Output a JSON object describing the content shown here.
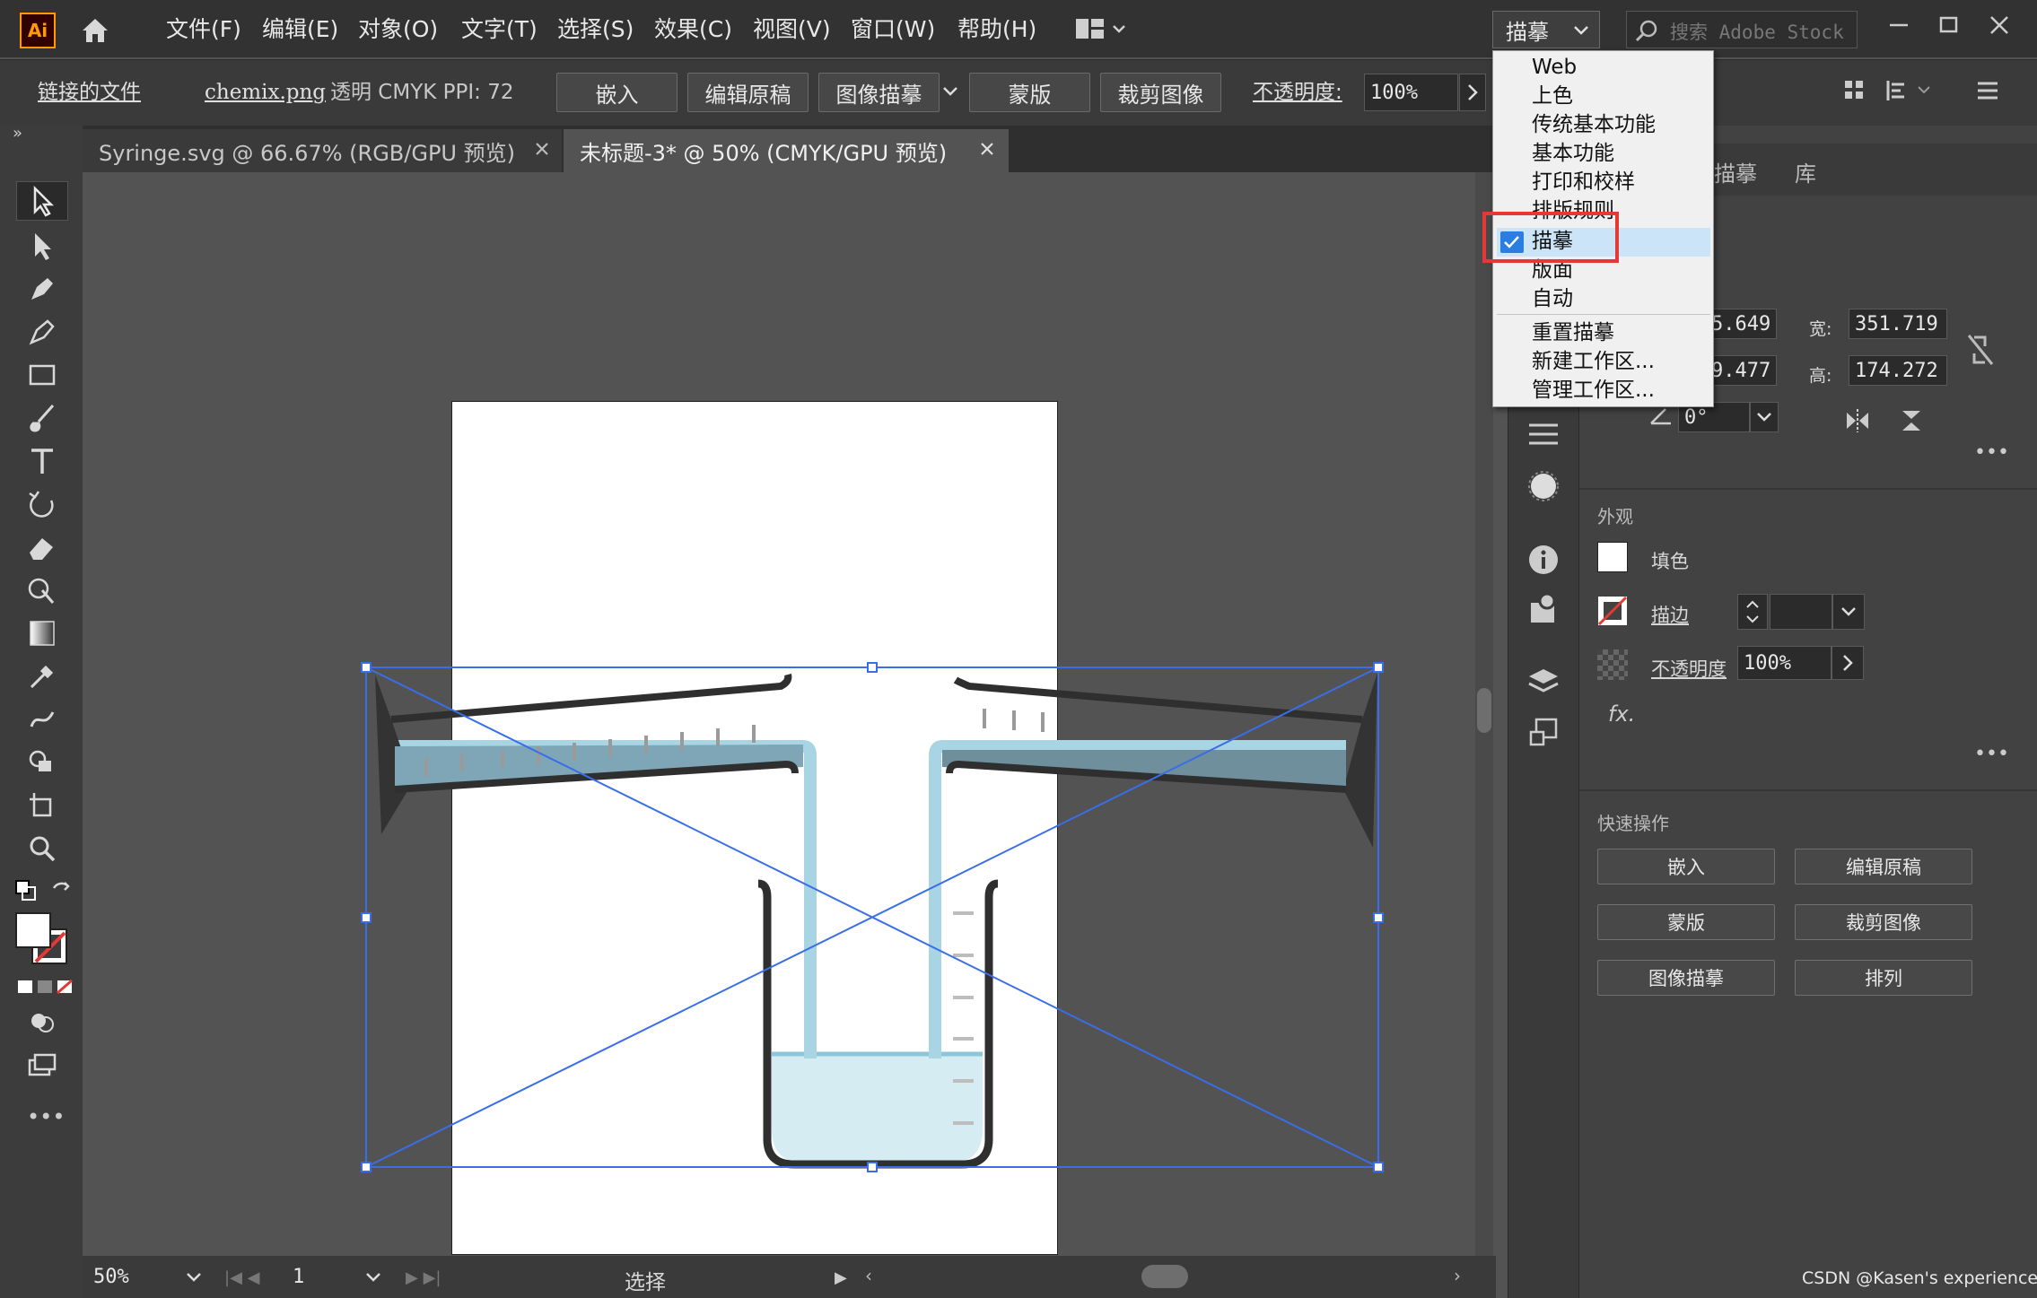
{
  "app": {
    "logo": "Ai"
  },
  "menu": [
    "文件(F)",
    "编辑(E)",
    "对象(O)",
    "文字(T)",
    "选择(S)",
    "效果(C)",
    "视图(V)",
    "窗口(W)",
    "帮助(H)"
  ],
  "workspace": {
    "current": "描摹",
    "search_placeholder": "搜索 Adobe Stock"
  },
  "control": {
    "linked_file_label": "链接的文件",
    "filename": "chemix.png",
    "info": "透明 CMYK PPI: 72",
    "embed": "嵌入",
    "edit_original": "编辑原稿",
    "image_trace": "图像描摹",
    "mask": "蒙版",
    "crop": "裁剪图像",
    "opacity_label": "不透明度:",
    "opacity_value": "100%"
  },
  "tabs": [
    {
      "label": "Syringe.svg @ 66.67% (RGB/GPU 预览)",
      "active": false
    },
    {
      "label": "未标题-3* @ 50% (CMYK/GPU 预览)",
      "active": true
    }
  ],
  "dropdown": {
    "items": [
      "Web",
      "上色",
      "传统基本功能",
      "基本功能",
      "打印和校样",
      "排版规则",
      "描摹",
      "版面",
      "自动"
    ],
    "checked": "描摹",
    "actions": [
      "重置描摹",
      "新建工作区...",
      "管理工作区..."
    ]
  },
  "panel": {
    "tabs": [
      "描摹",
      "库"
    ],
    "transform": {
      "x_partial": "5.649",
      "y_partial": "9.477",
      "w_label": "宽:",
      "w_value": "351.719",
      "h_label": "高:",
      "h_value": "174.272",
      "angle": "0°"
    },
    "appearance": {
      "title": "外观",
      "fill": "填色",
      "stroke": "描边",
      "opacity_label": "不透明度",
      "opacity_value": "100%",
      "fx": "fx."
    },
    "quick_actions": {
      "title": "快速操作",
      "buttons": [
        "嵌入",
        "编辑原稿",
        "蒙版",
        "裁剪图像",
        "图像描摹",
        "排列"
      ]
    }
  },
  "status": {
    "zoom": "50%",
    "page": "1",
    "tool": "选择"
  },
  "watermark": "CSDN @Kasen's experience",
  "colors": {
    "accent_selection": "#3a6ee8",
    "highlight_box": "#e53935",
    "check_blue": "#2a7de1"
  }
}
